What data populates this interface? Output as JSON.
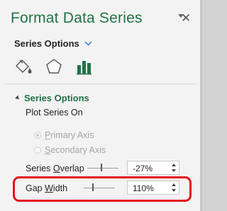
{
  "header": {
    "title": "Format Data Series",
    "close_label": "✕"
  },
  "series_dropdown": {
    "label": "Series Options"
  },
  "icon_tabs": [
    {
      "name": "fill-line-icon"
    },
    {
      "name": "effects-icon"
    },
    {
      "name": "series-options-icon"
    }
  ],
  "section": {
    "title": "Series Options",
    "plot_series_on_label": "Plot Series On",
    "primary_axis": {
      "prefix": "",
      "accel": "P",
      "rest": "rimary Axis",
      "selected": true
    },
    "secondary_axis": {
      "prefix": "",
      "accel": "S",
      "rest": "econdary Axis",
      "selected": false
    },
    "series_overlap": {
      "prefix": "Series ",
      "accel": "O",
      "rest": "verlap",
      "value": "-27%",
      "level": -0.27
    },
    "gap_width": {
      "prefix": "Gap ",
      "accel": "W",
      "rest": "idth",
      "value": "110%",
      "level": 1.1
    }
  },
  "colors": {
    "accent": "#217346",
    "highlight": "#e5121a"
  }
}
